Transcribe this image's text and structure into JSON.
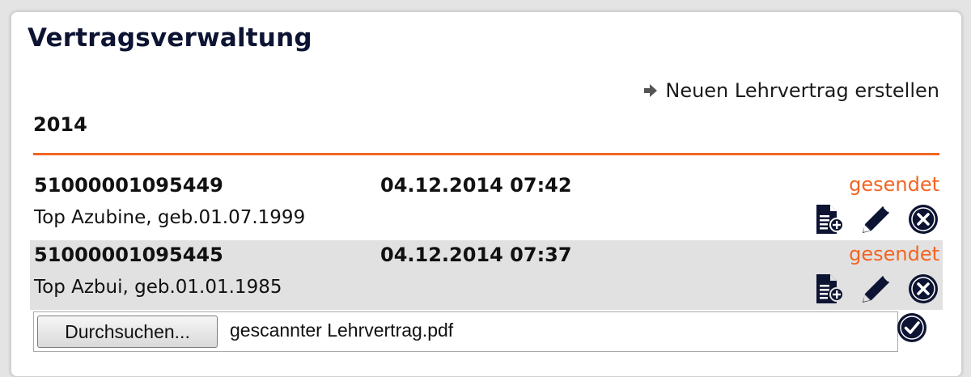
{
  "header": {
    "title": "Vertragsverwaltung",
    "new_contract_link": "Neuen Lehrvertrag erstellen"
  },
  "year_label": "2014",
  "colors": {
    "accent": "#f26522",
    "title": "#0d1433",
    "icon": "#0d1433",
    "alt_row": "#e1e1e1"
  },
  "contracts": [
    {
      "number": "51000001095449",
      "datetime": "04.12.2014 07:42",
      "status": "gesendet",
      "person": "Top Azubine, geb.01.07.1999",
      "actions": [
        "document-add-icon",
        "pencil-icon",
        "close-circle-icon"
      ]
    },
    {
      "number": "51000001095445",
      "datetime": "04.12.2014 07:37",
      "status": "gesendet",
      "person": "Top Azbui, geb.01.01.1985",
      "actions": [
        "document-add-icon",
        "pencil-icon",
        "close-circle-icon"
      ]
    }
  ],
  "upload": {
    "browse_label": "Durchsuchen...",
    "filename": "gescannter Lehrvertrag.pdf",
    "confirm_icon": "check-circle-icon"
  }
}
